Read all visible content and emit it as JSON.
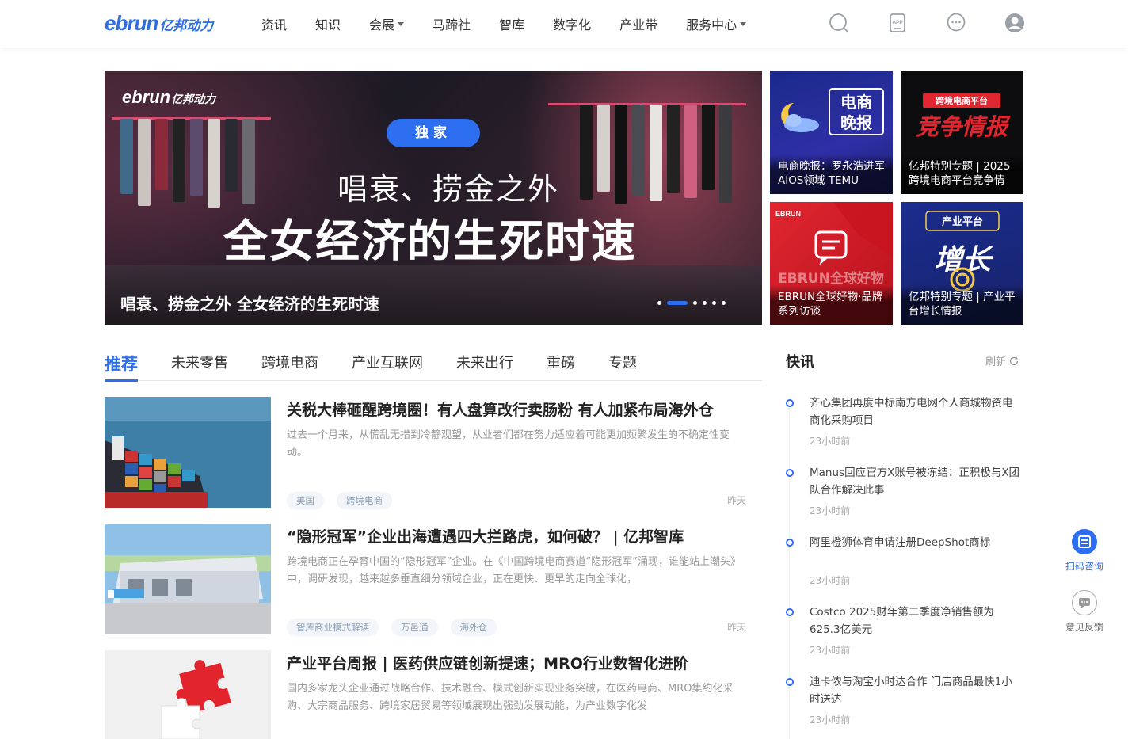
{
  "brand": {
    "logo_en": "ebrun",
    "logo_cn": "亿邦动力"
  },
  "nav": [
    {
      "label": "资讯",
      "dropdown": false
    },
    {
      "label": "知识",
      "dropdown": false
    },
    {
      "label": "会展",
      "dropdown": true
    },
    {
      "label": "马蹄社",
      "dropdown": false
    },
    {
      "label": "智库",
      "dropdown": false
    },
    {
      "label": "数字化",
      "dropdown": false
    },
    {
      "label": "产业带",
      "dropdown": false
    },
    {
      "label": "服务中心",
      "dropdown": true
    }
  ],
  "header_icons": [
    "search-icon",
    "app-icon",
    "message-icon",
    "user-avatar-icon"
  ],
  "header_icon_text": {
    "app": "APP"
  },
  "banner": {
    "logo_en": "ebrun",
    "logo_cn": "亿邦动力",
    "badge": "独家",
    "subtitle": "唱衰、捞金之外",
    "headline": "全女经济的生死时速",
    "caption": "唱衰、捞金之外 全女经济的生死时速",
    "slide_count": 6,
    "active_slide": 2
  },
  "tiles": [
    {
      "caption": "电商晚报：罗永浩进军AIOS领域 TEMU",
      "art_text": "电商晚报",
      "art_l1": "电商",
      "art_l2": "晚报"
    },
    {
      "caption": "亿邦特别专题 | 2025跨境电商平台竞争情",
      "art_top": "跨境电商平台",
      "art_text": "竞争情报"
    },
    {
      "caption": "EBRUN全球好物·品牌系列访谈",
      "art_top": "EBRUN",
      "art_text": "EBRUN全球好物"
    },
    {
      "caption": "亿邦特别专题 | 产业平台增长情报",
      "art_top": "产业平台",
      "art_text": "增长"
    }
  ],
  "tabs": [
    "推荐",
    "未来零售",
    "跨境电商",
    "产业互联网",
    "未来出行",
    "重磅",
    "专题"
  ],
  "active_tab": 0,
  "articles": [
    {
      "title": "关税大棒砸醒跨境圈！有人盘算改行卖肠粉 有人加紧布局海外仓",
      "desc": "过去一个月来，从慌乱无措到冷静观望，从业者们都在努力适应着可能更加频繁发生的不确定性变动。",
      "tags": [
        "美国",
        "跨境电商"
      ],
      "time": "昨天"
    },
    {
      "title": "“隐形冠军”企业出海遭遇四大拦路虎，如何破？ | 亿邦智库",
      "desc": "跨境电商正在孕育中国的“隐形冠军”企业。在《中国跨境电商赛道“隐形冠军”涌现，谁能站上潮头》中，调研发现，越来越多垂直细分领域企业，正在更快、更早的走向全球化，",
      "tags": [
        "智库商业模式解读",
        "万邑通",
        "海外仓"
      ],
      "time": "昨天"
    },
    {
      "title": "产业平台周报 | 医药供应链创新提速；MRO行业数智化进阶",
      "desc": "国内多家龙头企业通过战略合作、技术融合、模式创新实现业务突破，在医药电商、MRO集约化采购、大宗商品服务、跨境家居贸易等领域展现出强劲发展动能，为产业数字化发",
      "tags": [],
      "time": ""
    }
  ],
  "flash": {
    "title": "快讯",
    "refresh_label": "刷新",
    "items": [
      {
        "text": "齐心集团再度中标南方电网个人商城物资电商化采购项目",
        "time": "23小时前"
      },
      {
        "text": "Manus回应官方X账号被冻结：正积极与X团队合作解决此事",
        "time": "23小时前"
      },
      {
        "text": "阿里橙狮体育申请注册DeepShot商标",
        "time": "23小时前"
      },
      {
        "text": "Costco 2025财年第二季度净销售额为625.3亿美元",
        "time": "23小时前"
      },
      {
        "text": "迪卡侬与淘宝小时达合作 门店商品最快1小时送达",
        "time": "23小时前"
      }
    ]
  },
  "side": {
    "scan_label": "扫码咨询",
    "feedback_label": "意见反馈"
  },
  "colors": {
    "accent": "#2d6df0"
  }
}
